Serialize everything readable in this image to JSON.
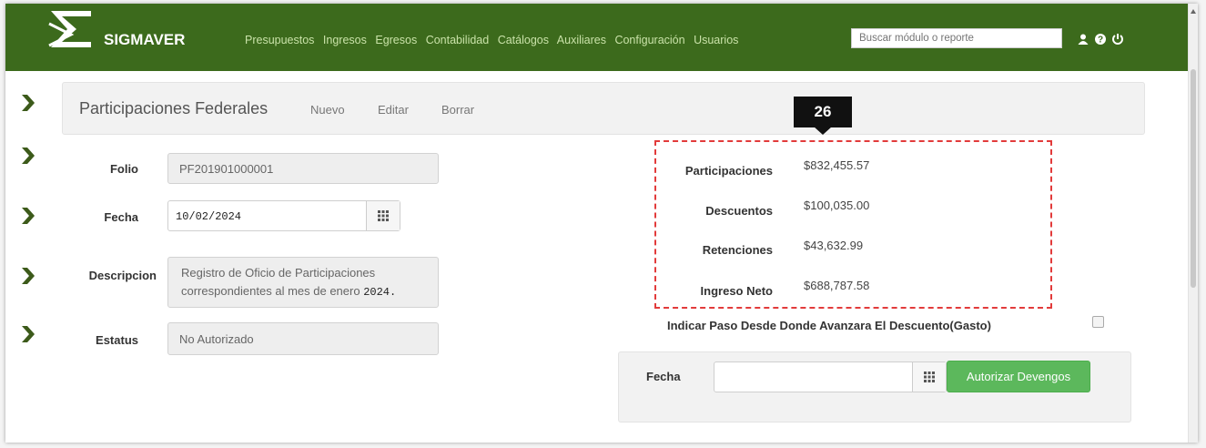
{
  "app": {
    "brand": "SIGMAVER"
  },
  "nav": {
    "links": [
      "Presupuestos",
      "Ingresos",
      "Egresos",
      "Contabilidad",
      "Catálogos",
      "Auxiliares",
      "Configuración",
      "Usuarios"
    ],
    "search_placeholder": "Buscar módulo o reporte",
    "icons": [
      "user-icon",
      "help-icon",
      "logout-icon"
    ]
  },
  "toolbar": {
    "title": "Participaciones Federales",
    "buttons": [
      "Nuevo",
      "Editar",
      "Borrar"
    ]
  },
  "form": {
    "folio": {
      "label": "Folio",
      "value": "PF201901000001"
    },
    "fecha": {
      "label": "Fecha",
      "value": "10/02/2024"
    },
    "descripcion": {
      "label": "Descripcion",
      "value_line1": "Registro de Oficio de Participaciones",
      "value_line2": "correspondientes al mes de enero",
      "value_year": "2024."
    },
    "estatus": {
      "label": "Estatus",
      "value": "No Autorizado"
    }
  },
  "callout": {
    "number": "26"
  },
  "summary": {
    "rows": [
      {
        "label": "Participaciones",
        "value": "$832,455.57"
      },
      {
        "label": "Descuentos",
        "value": "$100,035.00"
      },
      {
        "label": "Retenciones",
        "value": "$43,632.99"
      },
      {
        "label": "Ingreso Neto",
        "value": "$688,787.58"
      }
    ]
  },
  "gasto": {
    "checkbox_label": "Indicar Paso Desde Donde Avanzara El Descuento(Gasto)",
    "checked": false,
    "fecha_label": "Fecha",
    "fecha_value": "",
    "button": "Autorizar Devengos"
  },
  "colors": {
    "navbar": "#3c6a1c",
    "accent_green": "#5cb85c",
    "chevron": "#3c5a1a",
    "highlight": "#e23b3b"
  }
}
